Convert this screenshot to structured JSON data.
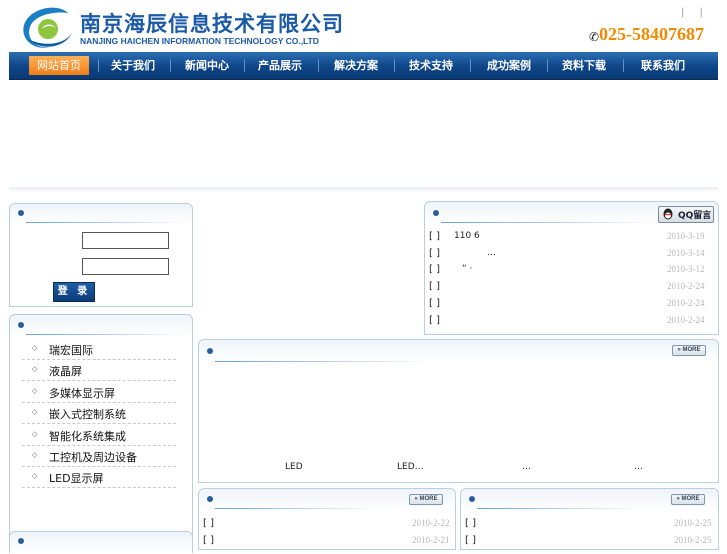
{
  "header": {
    "company_cn": "南京海辰信息技术有限公司",
    "company_en": "NANJING HAICHEN INFORMATION TECHNOLOGY CO.,LTD",
    "top_links": "| |",
    "phone": "025-58407687",
    "phone_icon": "phone-icon"
  },
  "nav": {
    "items": [
      "网站首页",
      "关于我们",
      "新闻中心",
      "产品展示",
      "解决方案",
      "技术支持",
      "成功案例",
      "资料下载",
      "联系我们"
    ],
    "active": 0
  },
  "login": {
    "button_label": "登 录"
  },
  "categories": {
    "items": [
      "瑞宏国际",
      "液晶屏",
      "多媒体显示屏",
      "嵌入式控制系统",
      "智能化系统集成",
      "工控机及周边设备",
      "LED显示屏"
    ]
  },
  "news": {
    "rows": [
      {
        "bracket": "[ ]",
        "title": "110   6",
        "date": "2010-3-19"
      },
      {
        "bracket": "[ ]",
        "title": "…",
        "date": "2010-3-14"
      },
      {
        "bracket": "[ ]",
        "title": "“ ·",
        "date": "2010-3-12"
      },
      {
        "bracket": "[ ]",
        "title": "",
        "date": "2010-2-24"
      },
      {
        "bracket": "[ ]",
        "title": "",
        "date": "2010-2-24"
      },
      {
        "bracket": "[ ]",
        "title": "",
        "date": "2010-2-24"
      }
    ],
    "qq_label": "QQ留言"
  },
  "products": {
    "more_label": "» MORE",
    "captions": [
      "LED",
      "LED…",
      "…",
      "…"
    ]
  },
  "bottom_left": {
    "more_label": "» MORE",
    "rows": [
      {
        "bracket": "[ ]",
        "date": "2010-2-22"
      },
      {
        "bracket": "[ ]",
        "date": "2010-2-21"
      }
    ]
  },
  "bottom_right": {
    "more_label": "» MORE",
    "rows": [
      {
        "bracket": "[ ]",
        "date": "2010-2-25"
      },
      {
        "bracket": "[ ]",
        "date": "2010-2-25"
      }
    ]
  },
  "colors": {
    "brand_blue": "#1b5aa6",
    "phone_orange": "#f28a00",
    "nav_active": "#f07d16"
  }
}
